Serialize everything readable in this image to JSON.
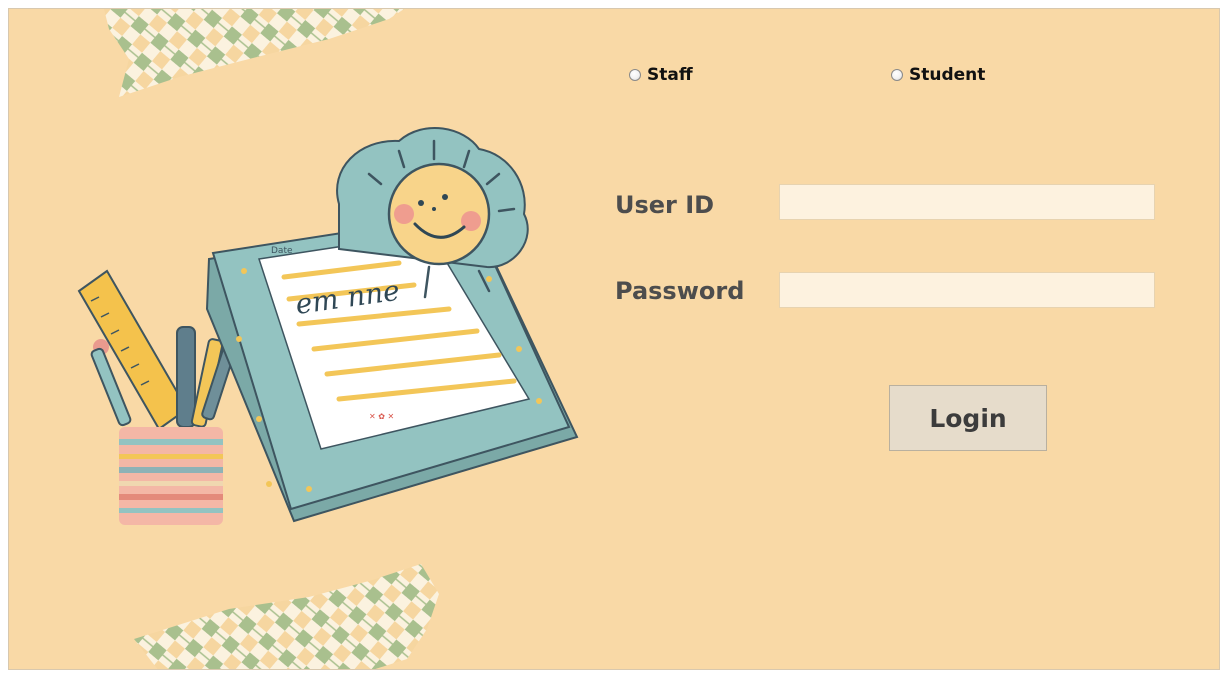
{
  "role_options": [
    {
      "label": "Staff",
      "selected": false
    },
    {
      "label": "Student",
      "selected": false
    }
  ],
  "form": {
    "user_id_label": "User ID",
    "user_id_value": "",
    "password_label": "Password",
    "password_value": "",
    "login_label": "Login"
  },
  "illustration": {
    "notebook_handwriting": "em nne",
    "notebook_header": "Date",
    "description_icons": [
      "notebook-icon",
      "sun-face-icon",
      "pencil-cup-icon",
      "ruler-icon",
      "argyle-ribbon-icon"
    ]
  },
  "colors": {
    "background": "#f9d9a6",
    "input_background": "#fdf2df",
    "button_background": "#e6dccb",
    "notebook_teal": "#93c3c1",
    "sun_yellow": "#f8d48a"
  }
}
